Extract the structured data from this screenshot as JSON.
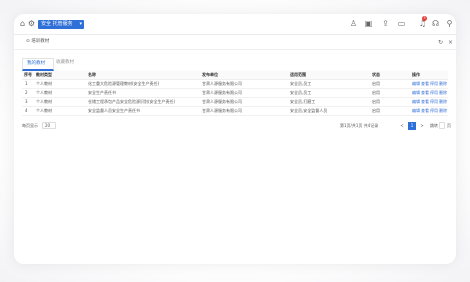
{
  "topbar": {
    "dropdown_label": "安全 托管服务",
    "notification_count": "3",
    "icons": [
      "home-icon",
      "settings-icon",
      "dropdown-chevron-icon",
      "user-icon",
      "message-icon",
      "upload-icon",
      "monitor-icon",
      "bell-icon",
      "headset-icon",
      "pin-icon"
    ]
  },
  "breadcrumb": "⊙ 培训教材",
  "tabs": [
    {
      "label": "我的教材",
      "active": true
    },
    {
      "label": "收藏教材",
      "active": false
    }
  ],
  "table": {
    "columns": [
      "序号",
      "教材类型",
      "名称",
      "发布单位",
      "适用范围",
      "状态",
      "操作"
    ],
    "rows": [
      {
        "no": "1",
        "type": "个人教材",
        "name": "化工重大危险源管理教材(安全生产责任)",
        "org": "甘肃人源服务有限公司",
        "scope": "安全员,员工",
        "status": "启用",
        "ops": [
          "编辑",
          "查看",
          "停用",
          "删除"
        ]
      },
      {
        "no": "2",
        "type": "个人教材",
        "name": "安全生产责任书",
        "org": "甘肃人源服务有限公司",
        "scope": "安全员,员工",
        "status": "启用",
        "ops": [
          "编辑",
          "查看",
          "停用",
          "删除"
        ]
      },
      {
        "no": "3",
        "type": "个人教材",
        "name": "仓储工程承包产品安全危险源识别(安全生产责任)",
        "org": "甘肃人源服务有限公司",
        "scope": "安全员,打磨工",
        "status": "启用",
        "ops": [
          "编辑",
          "查看",
          "停用",
          "删除"
        ]
      },
      {
        "no": "4",
        "type": "个人教材",
        "name": "安全监督人员安全生产责任书",
        "org": "甘肃人源服务有限公司",
        "scope": "安全员,安全监督人员",
        "status": "启用",
        "ops": [
          "编辑",
          "查看",
          "停用",
          "删除"
        ]
      }
    ]
  },
  "pagination": {
    "page_size_label": "每页显示",
    "page_size_value": "20",
    "total_text": "第1页/共1页 共4记录",
    "prev": "<",
    "current": "1",
    "next": ">",
    "goto_label": "跳转",
    "goto_suffix": "页",
    "go_button": "Go"
  },
  "colors": {
    "accent": "#2f6fd8",
    "badge": "#e53935"
  }
}
